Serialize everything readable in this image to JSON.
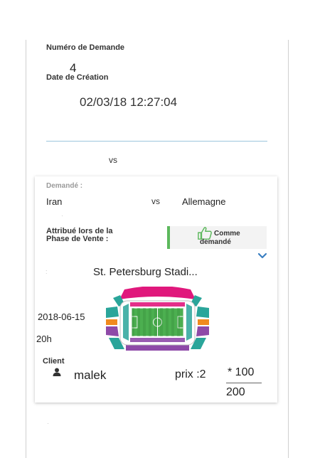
{
  "summary": {
    "numero_label": "Numéro de Demande",
    "numero_value": "4",
    "date_label": "Date de Création",
    "date_value": "02/03/18 12:27:04",
    "vs_text": "vs"
  },
  "demande": {
    "label": "Demandé :",
    "team_home": "Iran",
    "vs_text": "vs",
    "team_away": "Allemagne",
    "attribue_label_line1": "Attribué lors de la",
    "attribue_label_line2": "Phase de Vente :",
    "comme_btn_line1": "Comme",
    "comme_btn_line2": "demandé",
    "venue": "St. Petersburg Stadi...",
    "date": "2018-06-15",
    "time": "20h",
    "client_label": "Client",
    "client_name": "malek",
    "prix_text": "prix :2",
    "multiplier_text": "* 100",
    "total": "200"
  },
  "colors": {
    "accent_green": "#5cb85c",
    "divider_blue": "#9cc6dc",
    "chevron_blue": "#3a7fc1",
    "stadium_magenta": "#e0187c",
    "stadium_teal": "#2aa59a",
    "stadium_purple": "#8e4aa8",
    "stadium_orange": "#f08a1e",
    "pitch_green": "#4caf50"
  },
  "icons": {
    "thumbs_up": "thumbs-up-icon",
    "chevron": "chevron-down-icon",
    "user": "user-icon",
    "stadium": "stadium-map-icon"
  }
}
